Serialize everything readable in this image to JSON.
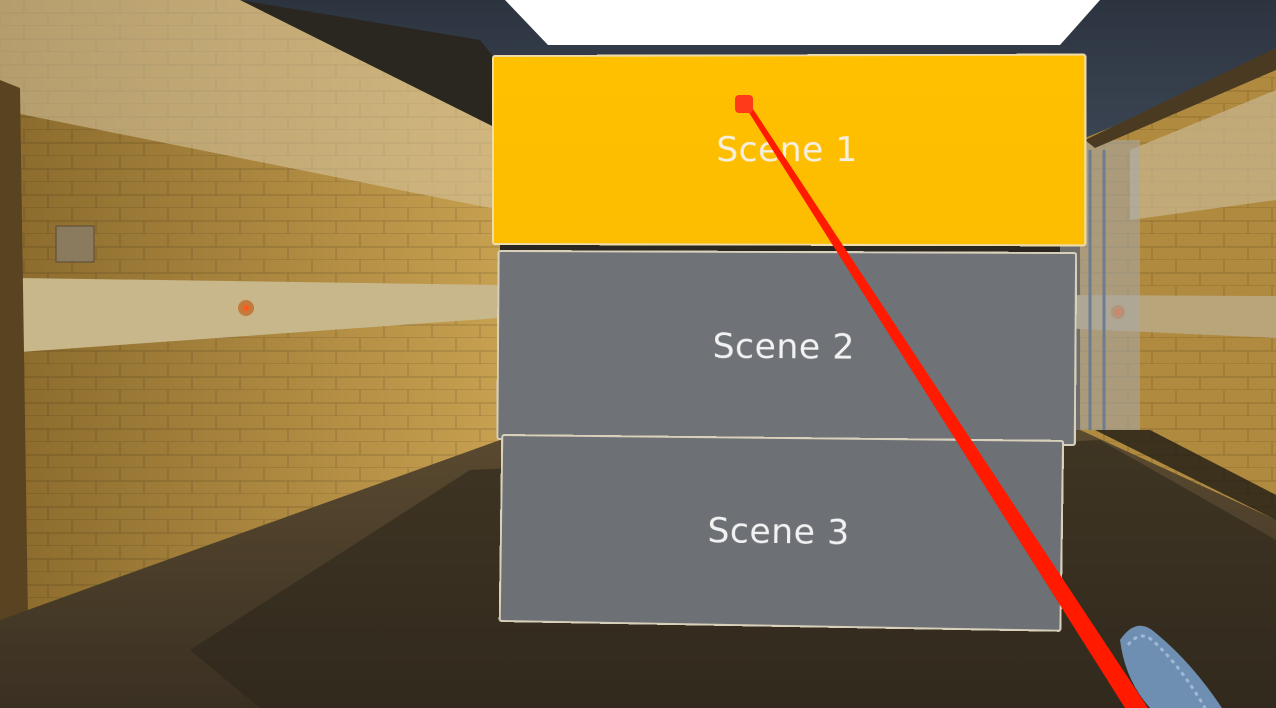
{
  "menu": {
    "buttons": [
      {
        "label": "Scene 1",
        "state": "hovered",
        "color": "#FFC000"
      },
      {
        "label": "Scene 2",
        "state": "normal",
        "color": "#6F7276"
      },
      {
        "label": "Scene 3",
        "state": "normal",
        "color": "#6D7074"
      }
    ]
  },
  "pointer": {
    "laser_color": "#FF1A00",
    "cursor_color": "#FF3A1A"
  },
  "environment": {
    "wall_color": "#C9A24A",
    "floor_color": "#3E3527",
    "ceiling_light_color": "#FFFFFF"
  },
  "controller": {
    "icon": "vr-controller-icon"
  }
}
